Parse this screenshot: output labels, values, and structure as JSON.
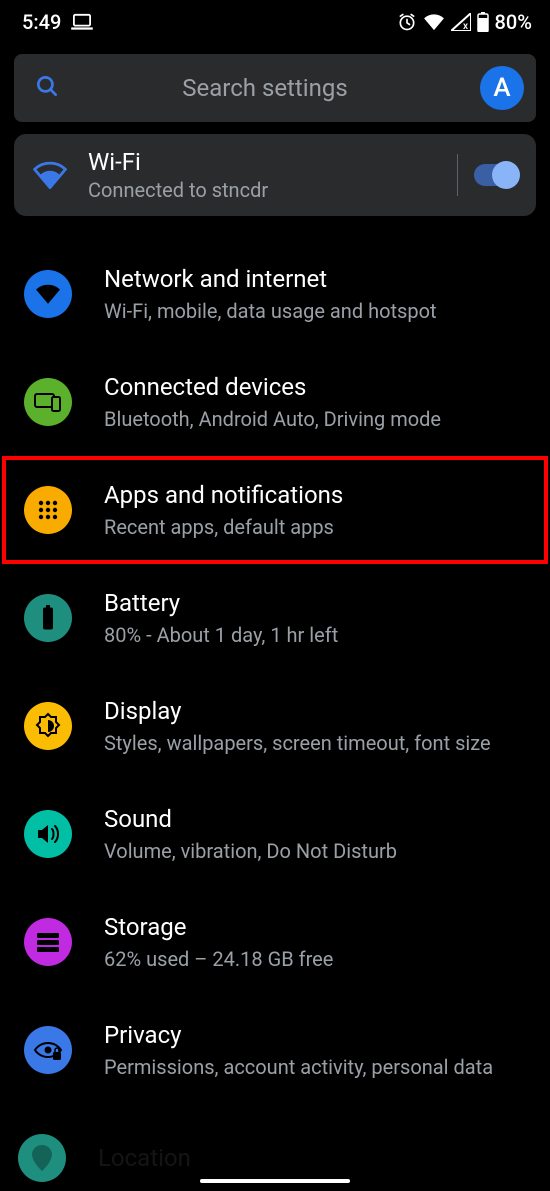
{
  "statusbar": {
    "time": "5:49",
    "battery_text": "80%"
  },
  "search": {
    "placeholder": "Search settings",
    "avatar_initial": "A"
  },
  "wifi_card": {
    "title": "Wi-Fi",
    "subtitle": "Connected to stncdr",
    "toggle_on": true
  },
  "items": [
    {
      "icon": "network",
      "title": "Network and internet",
      "sub": "Wi-Fi, mobile, data usage and hotspot",
      "highlight": false
    },
    {
      "icon": "connected",
      "title": "Connected devices",
      "sub": "Bluetooth, Android Auto, Driving mode",
      "highlight": false
    },
    {
      "icon": "apps",
      "title": "Apps and notifications",
      "sub": "Recent apps, default apps",
      "highlight": true
    },
    {
      "icon": "battery",
      "title": "Battery",
      "sub": "80% - About 1 day, 1 hr left",
      "highlight": false
    },
    {
      "icon": "display",
      "title": "Display",
      "sub": "Styles, wallpapers, screen timeout, font size",
      "highlight": false
    },
    {
      "icon": "sound",
      "title": "Sound",
      "sub": "Volume, vibration, Do Not Disturb",
      "highlight": false
    },
    {
      "icon": "storage",
      "title": "Storage",
      "sub": "62% used – 24.18 GB free",
      "highlight": false
    },
    {
      "icon": "privacy",
      "title": "Privacy",
      "sub": "Permissions, account activity, personal data",
      "highlight": false
    }
  ],
  "cutoff_item": {
    "icon": "location",
    "title": "Location"
  },
  "colors": {
    "accent": "#8ab4f8",
    "surface": "#2a2b2d",
    "highlight_border": "#ff0000"
  }
}
